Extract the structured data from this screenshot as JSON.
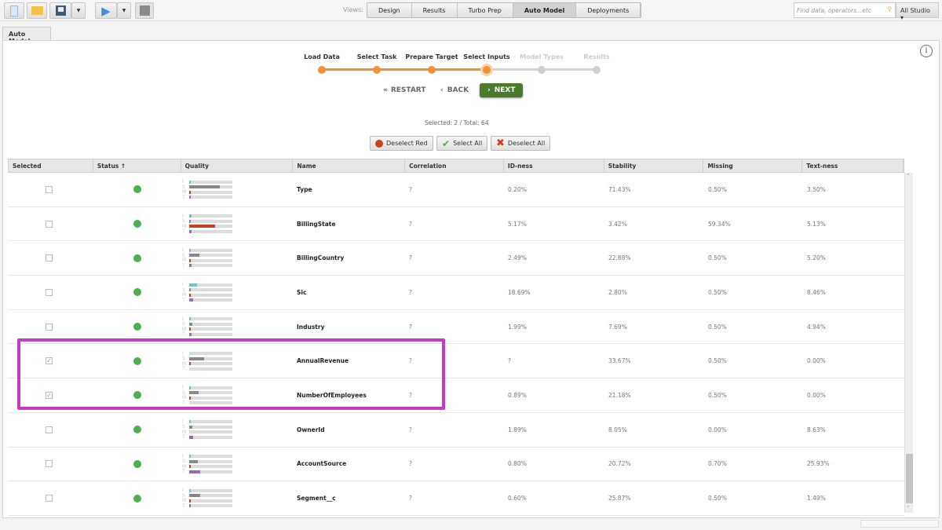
{
  "toolbar": {
    "views_label": "Views:",
    "views": [
      "Design",
      "Results",
      "Turbo Prep",
      "Auto Model",
      "Deployments"
    ],
    "active_view": "Auto Model",
    "search_placeholder": "Find data, operators...etc",
    "studio_label": "All Studio ▾"
  },
  "tab": "Auto Model",
  "steps": [
    {
      "label": "Load Data",
      "done": true
    },
    {
      "label": "Select Task",
      "done": true
    },
    {
      "label": "Prepare Target",
      "done": true
    },
    {
      "label": "Select Inputs",
      "done": true,
      "current": true
    },
    {
      "label": "Model Types",
      "done": false
    },
    {
      "label": "Results",
      "done": false
    }
  ],
  "nav": {
    "restart": "RESTART",
    "back": "BACK",
    "next": "NEXT"
  },
  "selection": "Selected: 2  /  Total: 64",
  "actions": {
    "deselect_red": "Deselect Red",
    "select_all": "Select All",
    "deselect_all": "Deselect All"
  },
  "columns": [
    "Selected",
    "Status ↑",
    "Quality",
    "Name",
    "Correlation",
    "ID-ness",
    "Stability",
    "Missing",
    "Text-ness"
  ],
  "quality_letters": [
    "I",
    "S",
    "M",
    "T"
  ],
  "colors": {
    "accent": "#f0913a",
    "next": "#4a7a2a",
    "status_ok": "#4caf50",
    "highlight": "#c63bc4",
    "id": "#6cc4d4",
    "stability": "#888888",
    "missing": "#c9421e",
    "text": "#9b6bb0"
  },
  "rows": [
    {
      "selected": false,
      "name": "Type",
      "correlation": "?",
      "idness": "0.20%",
      "stability": "71.43%",
      "missing": "0.50%",
      "textness": "3.50%"
    },
    {
      "selected": false,
      "name": "BillingState",
      "correlation": "?",
      "idness": "5.17%",
      "stability": "3.42%",
      "missing": "59.34%",
      "textness": "5.13%"
    },
    {
      "selected": false,
      "name": "BillingCountry",
      "correlation": "?",
      "idness": "2.49%",
      "stability": "22.88%",
      "missing": "0.50%",
      "textness": "5.20%"
    },
    {
      "selected": false,
      "name": "Sic",
      "correlation": "?",
      "idness": "18.69%",
      "stability": "2.80%",
      "missing": "0.50%",
      "textness": "8.46%"
    },
    {
      "selected": false,
      "name": "Industry",
      "correlation": "?",
      "idness": "1.99%",
      "stability": "7.69%",
      "missing": "0.50%",
      "textness": "4.94%"
    },
    {
      "selected": true,
      "name": "AnnualRevenue",
      "correlation": "?",
      "idness": "?",
      "stability": "33.67%",
      "missing": "0.50%",
      "textness": "0.00%"
    },
    {
      "selected": true,
      "name": "NumberOfEmployees",
      "correlation": "?",
      "idness": "0.89%",
      "stability": "21.18%",
      "missing": "0.50%",
      "textness": "0.00%"
    },
    {
      "selected": false,
      "name": "OwnerId",
      "correlation": "?",
      "idness": "1.89%",
      "stability": "8.05%",
      "missing": "0.00%",
      "textness": "8.63%"
    },
    {
      "selected": false,
      "name": "AccountSource",
      "correlation": "?",
      "idness": "0.80%",
      "stability": "20.72%",
      "missing": "0.70%",
      "textness": "25.93%"
    },
    {
      "selected": false,
      "name": "Segment__c",
      "correlation": "?",
      "idness": "0.60%",
      "stability": "25.87%",
      "missing": "0.50%",
      "textness": "1.49%"
    }
  ]
}
